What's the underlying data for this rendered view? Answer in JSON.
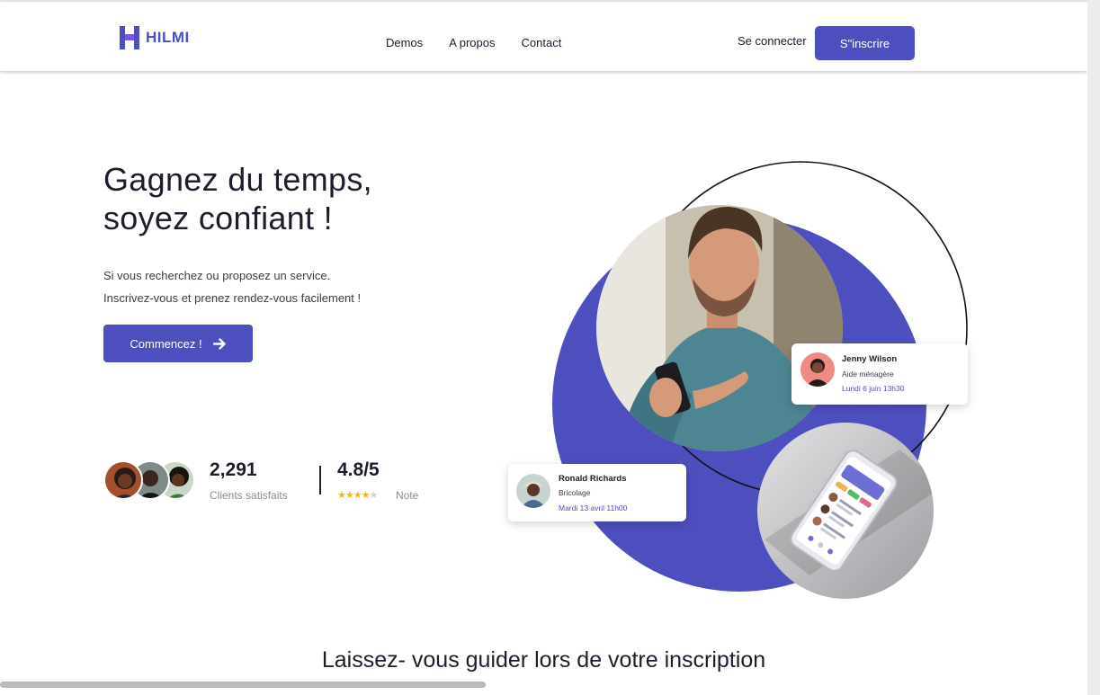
{
  "brand": {
    "name": "HILMI",
    "color": "#4e4fbf"
  },
  "nav": {
    "links": [
      "Demos",
      "A propos",
      "Contact"
    ],
    "signin_label": "Se connecter",
    "signup_label": "S\"inscrire"
  },
  "hero": {
    "title": "Gagnez du temps, soyez confiant !",
    "subtitle_line1": "Si vous recherchez ou proposez un service.",
    "subtitle_line2": "Inscrivez-vous et prenez rendez-vous facilement !",
    "cta_label": "Commencez !",
    "cta_icon": "arrow-right-icon"
  },
  "stats": {
    "clients_value": "2,291",
    "clients_label": "Clients satisfaits",
    "rating_value": "4.8/5",
    "rating_label": "Note",
    "rating_stars": 4,
    "rating_star_total": 5
  },
  "cards": {
    "jenny": {
      "name": "Jenny Wilson",
      "role": "Aide ménagère",
      "date": "Lundi 6 juin 13h30"
    },
    "ronald": {
      "name": "Ronald Richards",
      "role": "Bricolage",
      "date": "Mardi 13 avril 11h00"
    }
  },
  "section": {
    "title": "Laissez- vous guider lors de votre inscription"
  }
}
